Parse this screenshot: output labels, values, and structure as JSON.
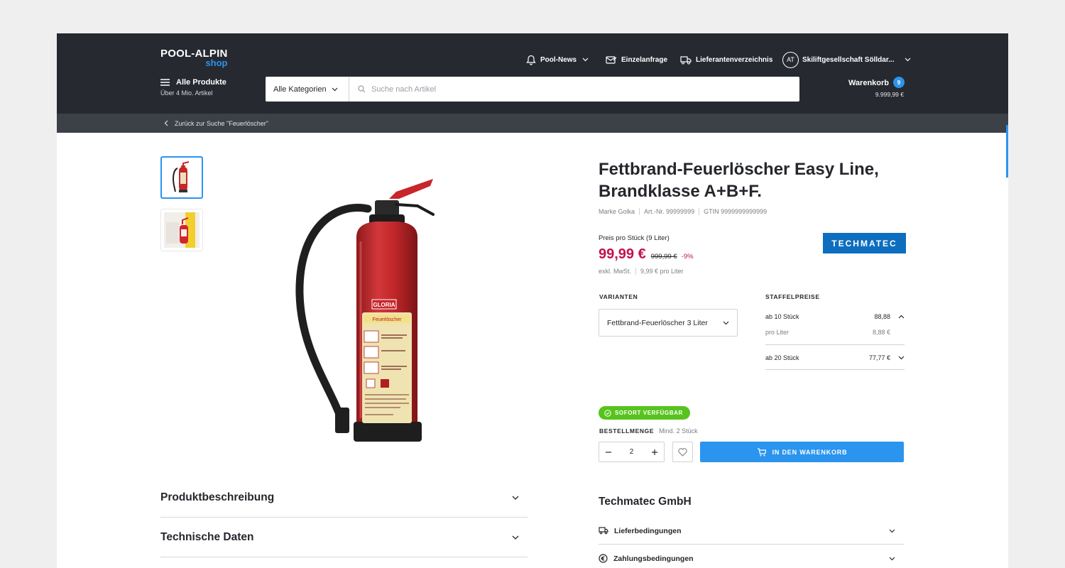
{
  "header": {
    "logo_main": "POOL-ALPIN",
    "logo_sub": "shop",
    "nav": {
      "news": "Pool-News",
      "einzelanfrage": "Einzelanfrage",
      "lieferanten": "Lieferantenverzeichnis",
      "account_initials": "AT",
      "account_name": "Skiliftgesellschaft Sölldar..."
    },
    "all_products": "Alle Produkte",
    "all_products_sub": "Über 4 Mio. Artikel",
    "search": {
      "category": "Alle Kategorien",
      "placeholder": "Suche nach Artikel"
    },
    "cart": {
      "label": "Warenkorb",
      "count": "9",
      "total": "9.999,99 €"
    }
  },
  "breadcrumb": {
    "back": "Zurück zur Suche \"Feuerlöscher\""
  },
  "product": {
    "title": "Fettbrand-Feuerlöscher Easy Line, Brandklasse A+B+F.",
    "brand": "Marke Golka",
    "article_no": "Art.-Nr. 99999999",
    "gtin": "GTIN 9999999999999",
    "brand_logo": "TECHMATEC",
    "price_label": "Preis pro Stück (9 Liter)",
    "price": "99,99 €",
    "old_price": "999,99 €",
    "discount": "-9%",
    "tax_note": "exkl. MwSt.",
    "unit_price": "9,99 € pro Liter",
    "image_label_brand": "GLORIA",
    "image_label_type": "Feuerlöscher"
  },
  "variants": {
    "label": "VARIANTEN",
    "selected": "Fettbrand-Feuerlöscher 3 Liter"
  },
  "staffelpreise": {
    "label": "STAFFELPREISE",
    "tiers": [
      {
        "qty": "ab 10 Stück",
        "price": "88,88",
        "sub_label": "pro Liter",
        "sub_price": "8,88 €",
        "expanded": true
      },
      {
        "qty": "ab 20 Stück",
        "price": "77,77 €",
        "expanded": false
      }
    ]
  },
  "availability": "SOFORT VERFÜGBAR",
  "order": {
    "label": "BESTELLMENGE",
    "min": "Mind. 2 Stück",
    "quantity": "2",
    "add_to_cart": "IN DEN WARENKORB"
  },
  "sections": {
    "description": "Produktbeschreibung",
    "technical": "Technische Daten"
  },
  "vendor": {
    "name": "Techmatec GmbH",
    "delivery": "Lieferbedingungen",
    "payment": "Zahlungsbedingungen"
  },
  "colors": {
    "header_bg": "#262930",
    "accent": "#2b94ee",
    "price": "#c3124d",
    "available": "#57c41e"
  }
}
